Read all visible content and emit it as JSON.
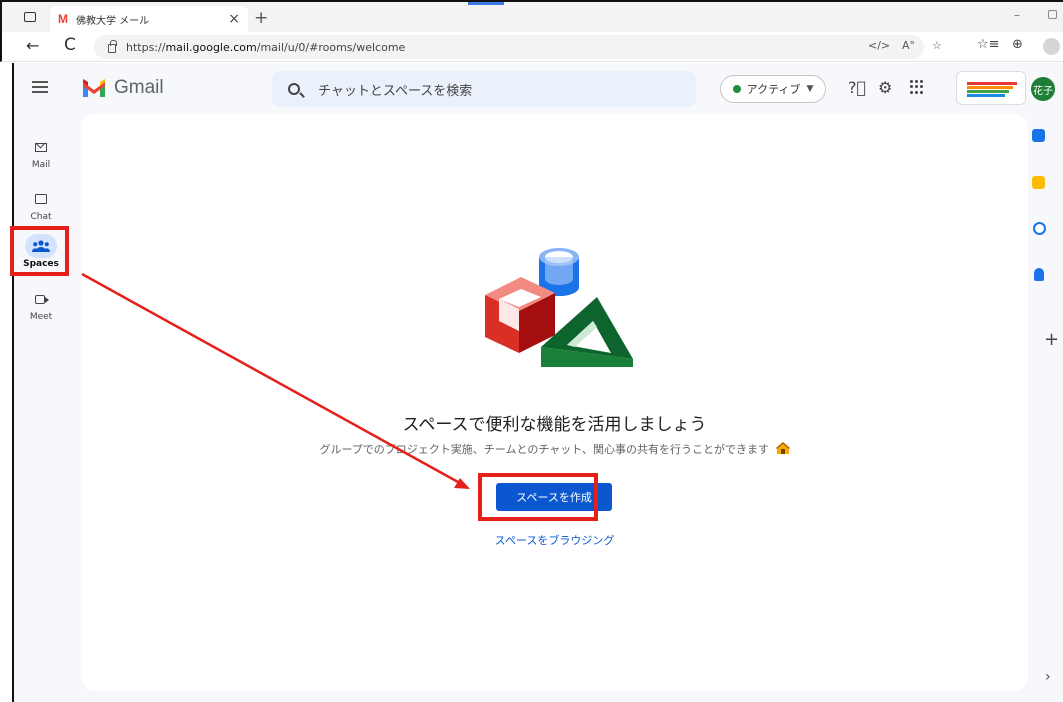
{
  "browser": {
    "tab_title": "佛教大学 メール",
    "tab_close": "×",
    "new_tab": "+",
    "url_prefix": "https://",
    "url_host": "mail.google.com",
    "url_path": "/mail/u/0/#rooms/welcome",
    "minimize": "–",
    "back": "←",
    "reload": "C",
    "address_icons": [
      "reader-mode-icon",
      "read-aloud-icon",
      "favorite-icon"
    ],
    "toolbar_icons": [
      "favorites-icon",
      "collections-icon"
    ]
  },
  "gmail": {
    "logo_text": "Gmail",
    "search_placeholder": "チャットとスペースを検索",
    "status_label": "アクティブ",
    "status_color": "#1e8e3e",
    "avatar_text": "花子"
  },
  "rail": {
    "items": [
      {
        "label": "Mail",
        "icon": "mail-icon",
        "selected": false
      },
      {
        "label": "Chat",
        "icon": "chat-icon",
        "selected": false
      },
      {
        "label": "Spaces",
        "icon": "spaces-icon",
        "selected": true
      },
      {
        "label": "Meet",
        "icon": "meet-icon",
        "selected": false
      }
    ]
  },
  "main": {
    "title": "スペースで便利な機能を活用しましょう",
    "subtitle": "グループでのプロジェクト実施、チームとのチャット、関心事の共有を行うことができます",
    "create_button": "スペースを作成",
    "browse_link": "スペースをブラウジング"
  },
  "side_panel": {
    "apps": [
      {
        "name": "calendar-icon",
        "color": "#1a73e8"
      },
      {
        "name": "keep-icon",
        "color": "#fbbc04"
      },
      {
        "name": "tasks-icon",
        "color": "#1a73e8"
      },
      {
        "name": "contacts-icon",
        "color": "#1a73e8"
      }
    ],
    "add": "+",
    "expand": "›"
  },
  "annotation_color": "#e5201b"
}
